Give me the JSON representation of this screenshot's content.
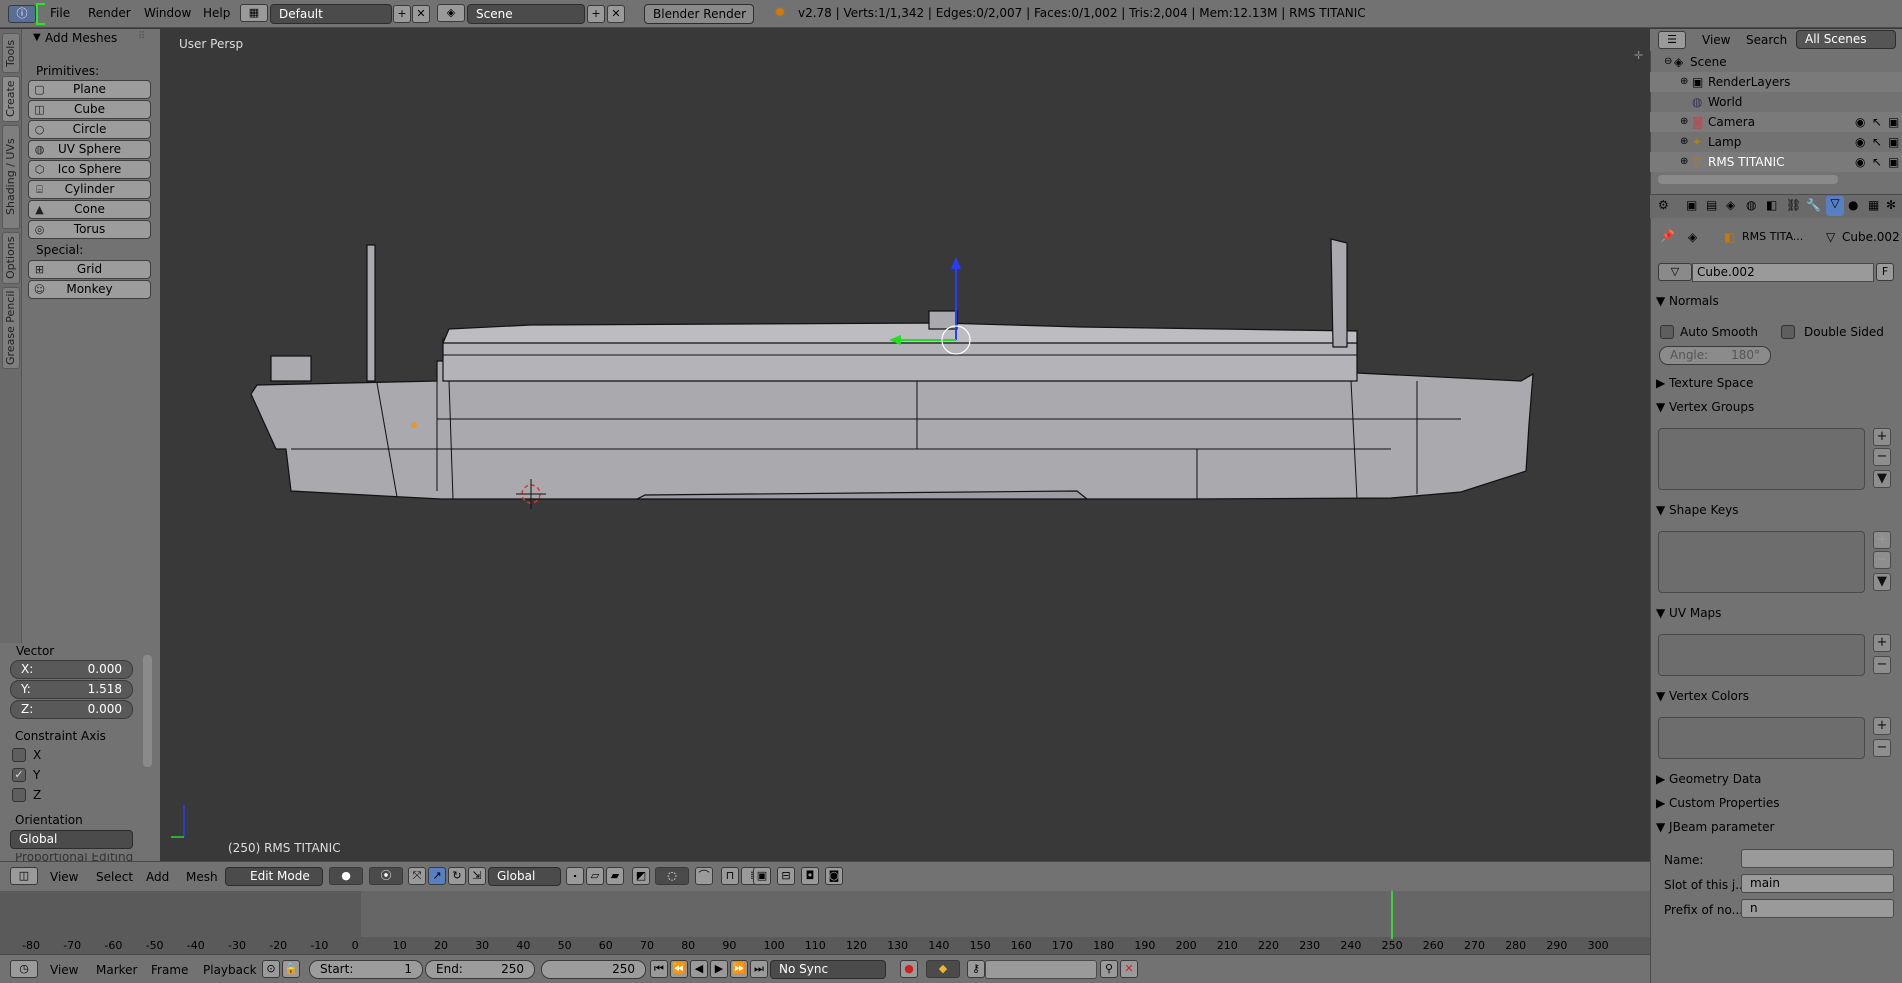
{
  "topbar": {
    "menus": [
      "File",
      "Render",
      "Window",
      "Help"
    ],
    "layout": "Default",
    "scene": "Scene",
    "engine": "Blender Render",
    "stats": "v2.78 | Verts:1/1,342 | Edges:0/2,007 | Faces:0/1,002 | Tris:2,004 | Mem:12.13M | RMS TITANIC"
  },
  "toolshelf": {
    "tabs": [
      "Tools",
      "Create",
      "Shading / UVs",
      "Options",
      "Grease Pencil"
    ],
    "panel_title": "Add Meshes",
    "primitives_label": "Primitives:",
    "primitives": [
      "Plane",
      "Cube",
      "Circle",
      "UV Sphere",
      "Ico Sphere",
      "Cylinder",
      "Cone",
      "Torus"
    ],
    "special_label": "Special:",
    "special": [
      "Grid",
      "Monkey"
    ],
    "operator": {
      "vector_label": "Vector",
      "x_label": "X:",
      "x": "0.000",
      "y_label": "Y:",
      "y": "1.518",
      "z_label": "Z:",
      "z": "0.000",
      "constraint_label": "Constraint Axis",
      "axes": [
        "X",
        "Y",
        "Z"
      ],
      "axis_checked": [
        false,
        true,
        false
      ],
      "orientation_label": "Orientation",
      "orientation": "Global",
      "next_label": "Proportional Editing"
    }
  },
  "viewport": {
    "view_label": "User Persp",
    "object_label": "(250) RMS TITANIC"
  },
  "header3d": {
    "items": [
      "View",
      "Select",
      "Add",
      "Mesh"
    ],
    "mode": "Edit Mode",
    "orientation": "Global"
  },
  "timeline": {
    "ticks": [
      "-80",
      "-70",
      "-60",
      "-50",
      "-40",
      "-30",
      "-20",
      "-10",
      "0",
      "10",
      "20",
      "30",
      "40",
      "50",
      "60",
      "70",
      "80",
      "90",
      "100",
      "110",
      "120",
      "130",
      "140",
      "150",
      "160",
      "170",
      "180",
      "190",
      "200",
      "210",
      "220",
      "230",
      "240",
      "250",
      "260",
      "270",
      "280",
      "290",
      "300"
    ],
    "current_frame": 250
  },
  "bottombar": {
    "items": [
      "View",
      "Marker",
      "Frame",
      "Playback"
    ],
    "start_label": "Start:",
    "start": "1",
    "end_label": "End:",
    "end": "250",
    "frame": "250",
    "sync": "No Sync"
  },
  "outliner": {
    "menus": [
      "View",
      "Search"
    ],
    "filter": "All Scenes",
    "rows": [
      "Scene",
      "RenderLayers",
      "World",
      "Camera",
      "Lamp",
      "RMS TITANIC"
    ]
  },
  "properties": {
    "breadcrumb_object": "RMS TITA...",
    "breadcrumb_mesh": "Cube.002",
    "mesh_name": "Cube.002",
    "fake_user": "F",
    "sections": {
      "normals": "Normals",
      "auto_smooth": "Auto Smooth",
      "double_sided": "Double Sided",
      "angle": "Angle:",
      "angle_value": "180°",
      "texture_space": "Texture Space",
      "vertex_groups": "Vertex Groups",
      "shape_keys": "Shape Keys",
      "uv_maps": "UV Maps",
      "vertex_colors": "Vertex Colors",
      "geometry_data": "Geometry Data",
      "custom_properties": "Custom Properties",
      "jbeam": "JBeam parameter"
    },
    "jbeam": {
      "name_label": "Name:",
      "name_value": "",
      "slot_label": "Slot of this j...",
      "slot_value": "main",
      "prefix_label": "Prefix of no...",
      "prefix_value": "n"
    }
  },
  "colors": {
    "panel": "#727272",
    "viewport": "#393939",
    "accent": "#5680c2",
    "frame_line": "#3ecf3e"
  }
}
